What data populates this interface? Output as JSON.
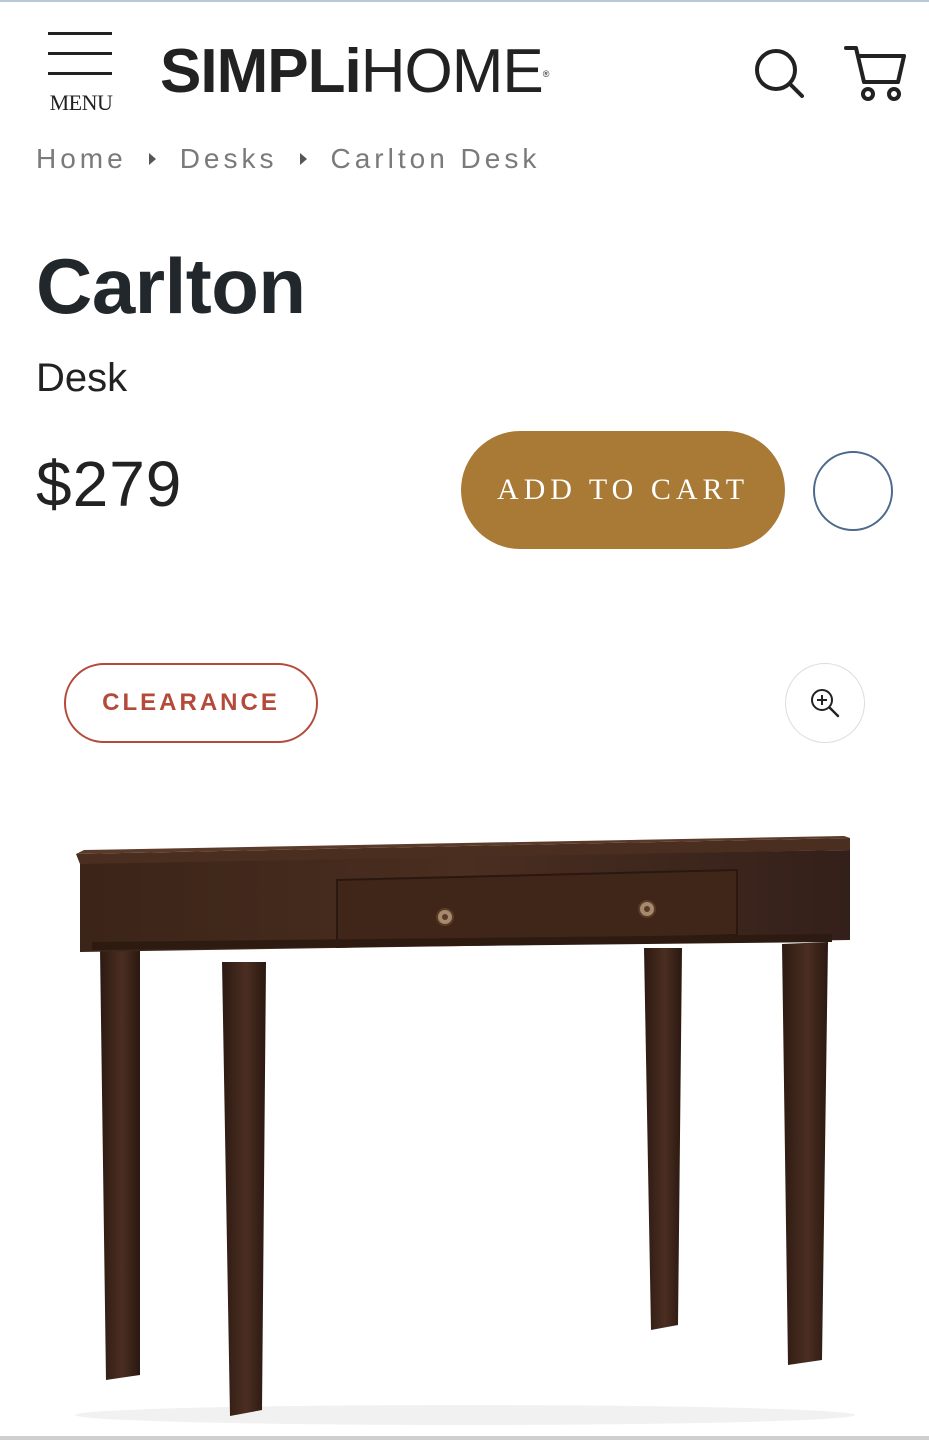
{
  "header": {
    "menu_label": "MENU",
    "logo_bold": "SIMPLi",
    "logo_light": "HOME",
    "logo_mark": "®"
  },
  "breadcrumb": {
    "items": [
      "Home",
      "Desks",
      "Carlton Desk"
    ]
  },
  "product": {
    "name": "Carlton",
    "type": "Desk",
    "price": "$279",
    "add_to_cart_label": "ADD TO CART",
    "badge": "CLEARANCE"
  },
  "icons": {
    "menu": "hamburger-icon",
    "search": "search-icon",
    "cart": "cart-icon",
    "zoom": "zoom-in-icon",
    "wishlist": "wishlist-circle-icon"
  },
  "colors": {
    "accent_button": "#a97a36",
    "clearance": "#b34a3a",
    "wishlist_border": "#4b6a8c",
    "text_dark": "#22272b",
    "breadcrumb": "#7a7a7a"
  }
}
